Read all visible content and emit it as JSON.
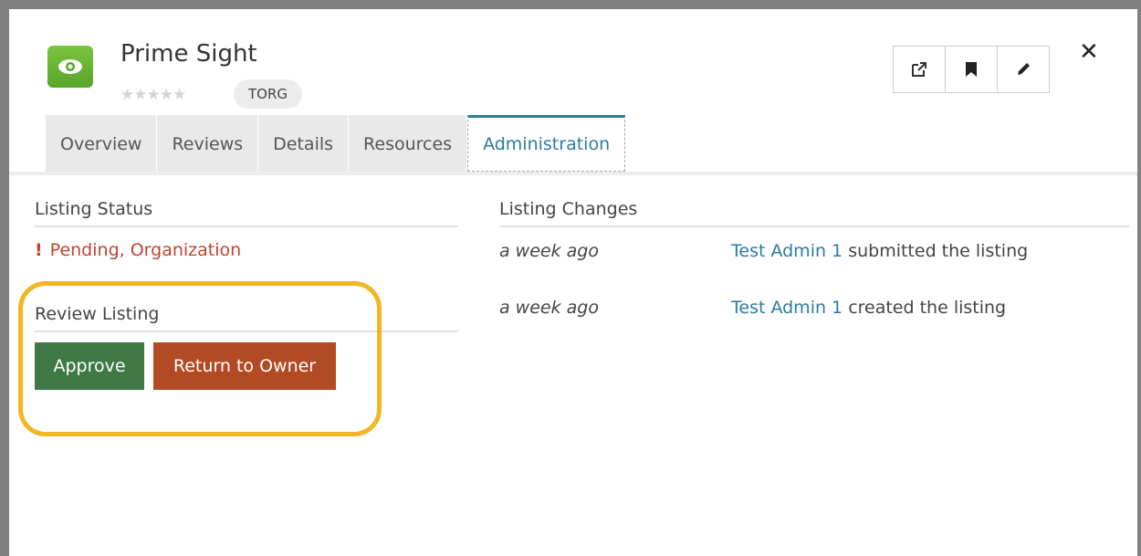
{
  "listing": {
    "title": "Prime Sight",
    "rating_stars": "★★★★★",
    "tag": "TORG"
  },
  "tabs": [
    "Overview",
    "Reviews",
    "Details",
    "Resources",
    "Administration"
  ],
  "active_tab": "Administration",
  "actions": {
    "icons": [
      "external-link-icon",
      "bookmark-icon",
      "pencil-icon"
    ],
    "close": "✕"
  },
  "status": {
    "title": "Listing Status",
    "alert": "!",
    "value": "Pending, Organization"
  },
  "review": {
    "title": "Review Listing",
    "approve_label": "Approve",
    "return_label": "Return to Owner"
  },
  "changes": {
    "title": "Listing Changes",
    "entries": [
      {
        "time": "a week ago",
        "user": "Test Admin 1",
        "action": "submitted the listing"
      },
      {
        "time": "a week ago",
        "user": "Test Admin 1",
        "action": "created the listing"
      }
    ]
  },
  "colors": {
    "accent": "#2b7aa3",
    "approve": "#3f7a46",
    "return": "#b24a23",
    "status": "#c0442f",
    "highlight": "#f2b622"
  }
}
